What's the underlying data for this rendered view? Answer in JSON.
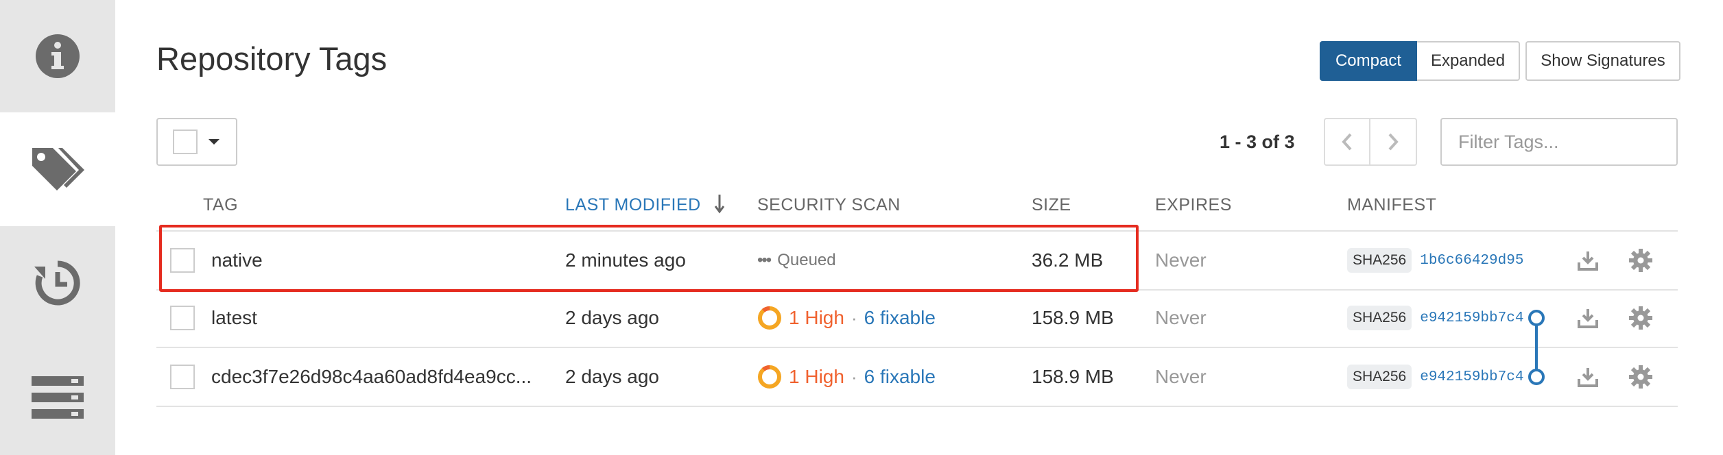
{
  "page": {
    "title": "Repository Tags"
  },
  "view_toggle": {
    "compact": "Compact",
    "expanded": "Expanded",
    "signatures": "Show Signatures",
    "active": "Compact"
  },
  "pagination": {
    "text": "1 - 3 of 3"
  },
  "filter": {
    "placeholder": "Filter Tags..."
  },
  "sidebar": {
    "items": [
      {
        "icon": "info-icon",
        "active": false
      },
      {
        "icon": "tags-icon",
        "active": true
      },
      {
        "icon": "history-icon",
        "active": false
      },
      {
        "icon": "builds-icon",
        "active": false
      }
    ]
  },
  "columns": {
    "tag": "TAG",
    "last_modified": "LAST MODIFIED",
    "security_scan": "SECURITY SCAN",
    "size": "SIZE",
    "expires": "EXPIRES",
    "manifest": "MANIFEST"
  },
  "sort": {
    "column": "LAST MODIFIED",
    "direction": "descending"
  },
  "tags": [
    {
      "name": "native",
      "last_modified": "2 minutes ago",
      "scan": {
        "status": "Queued"
      },
      "size": "36.2 MB",
      "expires": "Never",
      "sha_label": "SHA256",
      "digest": "1b6c66429d95"
    },
    {
      "name": "latest",
      "last_modified": "2 days ago",
      "scan": {
        "high": "1 High",
        "fixable": "6 fixable"
      },
      "size": "158.9 MB",
      "expires": "Never",
      "sha_label": "SHA256",
      "digest": "e942159bb7c4"
    },
    {
      "name": "cdec3f7e26d98c4aa60ad8fd4ea9cc...",
      "last_modified": "2 days ago",
      "scan": {
        "high": "1 High",
        "fixable": "6 fixable"
      },
      "size": "158.9 MB",
      "expires": "Never",
      "sha_label": "SHA256",
      "digest": "e942159bb7c4"
    }
  ],
  "colors": {
    "accent": "#1f5f95",
    "link": "#2a77b8",
    "high": "#f0612e",
    "highlight": "#e52b1f"
  }
}
